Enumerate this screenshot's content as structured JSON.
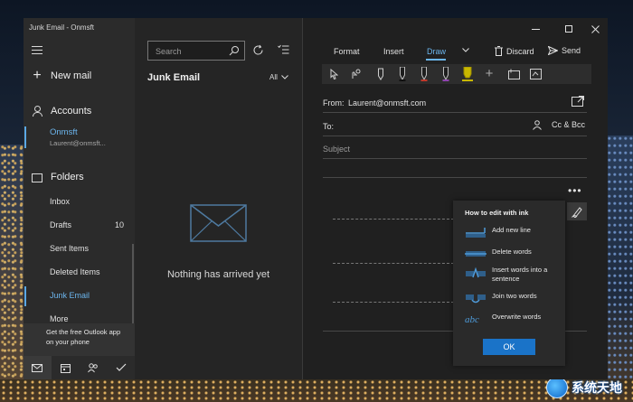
{
  "window": {
    "title": "Junk Email - Onmsft"
  },
  "sidebar": {
    "new_mail": "New mail",
    "accounts_label": "Accounts",
    "account": {
      "name": "Onmsft",
      "email": "Laurent@onmsft..."
    },
    "folders_label": "Folders",
    "folders": [
      {
        "label": "Inbox",
        "count": ""
      },
      {
        "label": "Drafts",
        "count": "10"
      },
      {
        "label": "Sent Items",
        "count": ""
      },
      {
        "label": "Deleted Items",
        "count": ""
      },
      {
        "label": "Junk Email",
        "count": ""
      },
      {
        "label": "More",
        "count": ""
      }
    ],
    "promo": "Get the free Outlook app on your phone",
    "bottom_nav": [
      "mail-icon",
      "calendar-icon",
      "people-icon",
      "todo-icon"
    ]
  },
  "list": {
    "search_placeholder": "Search",
    "title": "Junk Email",
    "filter": "All",
    "empty_text": "Nothing has arrived yet"
  },
  "compose": {
    "tabs": [
      "Format",
      "Insert",
      "Draw"
    ],
    "active_tab": "Draw",
    "discard": "Discard",
    "send": "Send",
    "from_label": "From:",
    "from_value": "Laurent@onmsft.com",
    "to_label": "To:",
    "cc_bcc": "Cc & Bcc",
    "subject_placeholder": "Subject",
    "ink_help": {
      "title": "How to edit with ink",
      "items": [
        "Add new line",
        "Delete words",
        "Insert words into a sentence",
        "Join two words",
        "Overwrite words"
      ],
      "ok": "OK"
    }
  },
  "colors": {
    "accent": "#6cb6ee",
    "ok_button": "#1a73c8",
    "pen_red": "#c0392b",
    "pen_purple": "#8e44ad",
    "highlighter": "#c9b800"
  },
  "watermark": {
    "text": "系统天地"
  }
}
